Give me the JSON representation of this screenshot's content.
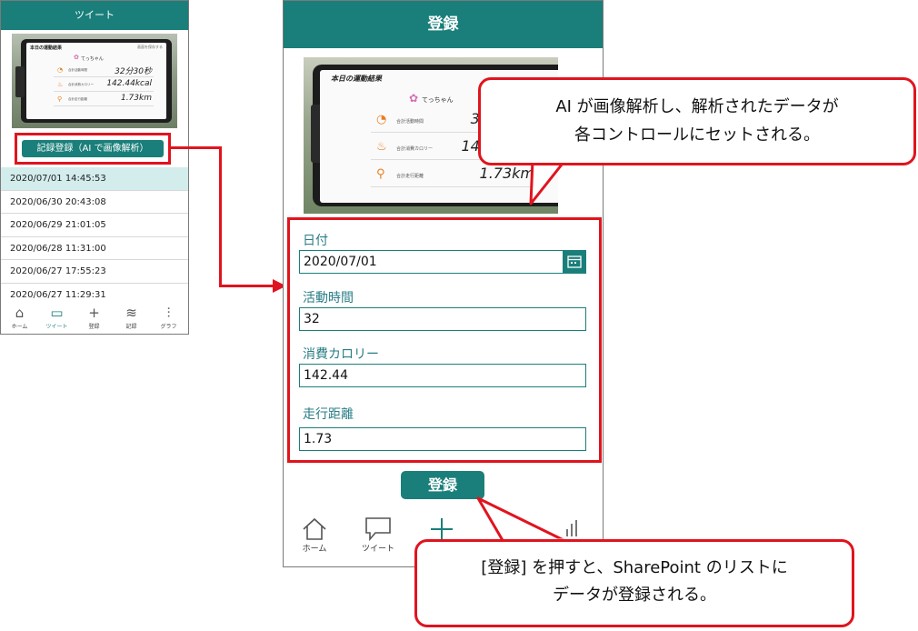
{
  "left_phone": {
    "header_title": "ツイート",
    "photo": {
      "screen_title": "本日の運動結果",
      "screen_corner": "画面を保存する",
      "user_name": "てっちゃん",
      "metrics": [
        {
          "icon": "stopwatch-icon",
          "label": "合計活動時間",
          "value": "32分30秒"
        },
        {
          "icon": "flame-icon",
          "label": "合計消費カロリー",
          "value": "142.44kcal"
        },
        {
          "icon": "runner-icon",
          "label": "合計走行距離",
          "value": "1.73km"
        }
      ]
    },
    "register_button": "記録登録（AI で画像解析）",
    "records": [
      "2020/07/01 14:45:53",
      "2020/06/30 20:43:08",
      "2020/06/29 21:01:05",
      "2020/06/28 11:31:00",
      "2020/06/27 17:55:23",
      "2020/06/27 11:29:31"
    ],
    "nav": [
      {
        "icon": "home-icon",
        "label": "ホーム"
      },
      {
        "icon": "chat-icon",
        "label": "ツイート"
      },
      {
        "icon": "plus-icon",
        "label": "登録"
      },
      {
        "icon": "database-icon",
        "label": "記録"
      },
      {
        "icon": "chart-icon",
        "label": "グラフ"
      }
    ]
  },
  "right_phone": {
    "header_title": "登録",
    "photo": {
      "screen_title": "本日の運動結果",
      "user_name": "てっちゃん",
      "metrics": [
        {
          "icon": "stopwatch-icon",
          "label": "合計活動時間",
          "value": "32"
        },
        {
          "icon": "flame-icon",
          "label": "合計消費カロリー",
          "value": "142"
        },
        {
          "icon": "runner-icon",
          "label": "合計走行距離",
          "value": "1.73km"
        }
      ]
    },
    "form": {
      "date_label": "日付",
      "date_value": "2020/07/01",
      "time_label": "活動時間",
      "time_value": "32",
      "calorie_label": "消費カロリー",
      "calorie_value": "142.44",
      "distance_label": "走行距離",
      "distance_value": "1.73"
    },
    "register_button": "登録",
    "nav": [
      {
        "icon": "home-icon",
        "label": "ホーム"
      },
      {
        "icon": "chat-icon",
        "label": "ツイート"
      },
      {
        "icon": "plus-icon",
        "label": ""
      }
    ]
  },
  "callouts": {
    "top_line1": "AI が画像解析し、解析されたデータが",
    "top_line2": "各コントロールにセットされる。",
    "bottom_line1": "[登録] を押すと、SharePoint のリストに",
    "bottom_line2": "データが登録される。"
  },
  "colors": {
    "accent": "#1a7f7a",
    "highlight": "#e0141e",
    "selected_row": "#d3ecec",
    "label_text": "#2a7d86"
  }
}
